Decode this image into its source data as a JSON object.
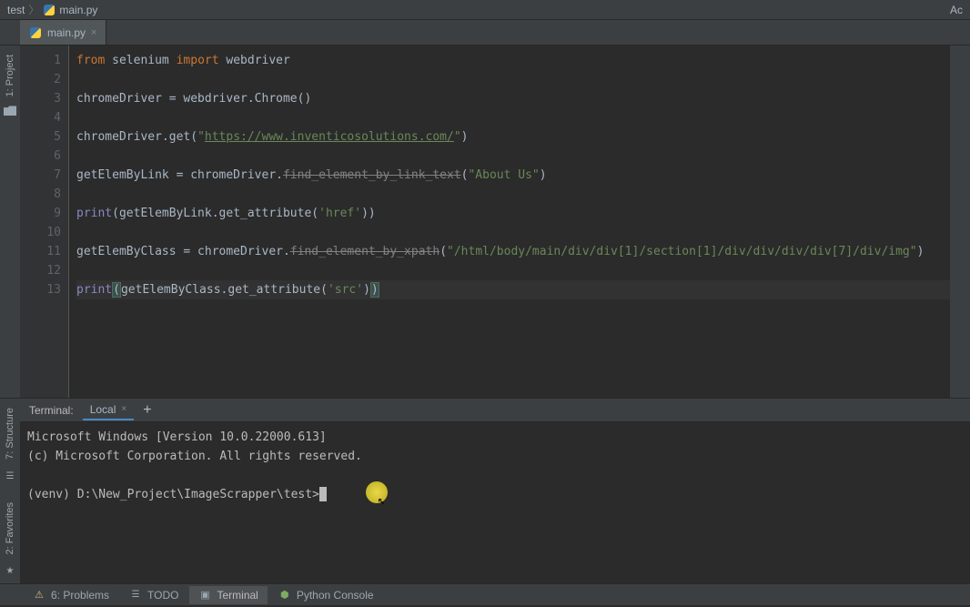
{
  "topnav": {
    "crumb_project": "test",
    "crumb_file": "main.py",
    "right": "Ac"
  },
  "tab": {
    "name": "main.py"
  },
  "sidebar": {
    "project_label": "1: Project"
  },
  "editor": {
    "line_count": 13,
    "code_tokens": [
      [
        {
          "t": "from",
          "c": "kw"
        },
        {
          "t": " ",
          "c": "ident"
        },
        {
          "t": "selenium",
          "c": "ident"
        },
        {
          "t": " ",
          "c": "ident"
        },
        {
          "t": "import",
          "c": "kw"
        },
        {
          "t": " ",
          "c": "ident"
        },
        {
          "t": "webdriver",
          "c": "ident"
        }
      ],
      [],
      [
        {
          "t": "chromeDriver = webdriver.Chrome()",
          "c": "ident"
        }
      ],
      [],
      [
        {
          "t": "chromeDriver.get(",
          "c": "ident"
        },
        {
          "t": "\"",
          "c": "str"
        },
        {
          "t": "https://www.inventicosolutions.com/",
          "c": "str-url"
        },
        {
          "t": "\"",
          "c": "str"
        },
        {
          "t": ")",
          "c": "ident"
        }
      ],
      [],
      [
        {
          "t": "getElemByLink = chromeDriver.",
          "c": "ident"
        },
        {
          "t": "find_element_by_link_text",
          "c": "deprecated"
        },
        {
          "t": "(",
          "c": "ident"
        },
        {
          "t": "\"About Us\"",
          "c": "str"
        },
        {
          "t": ")",
          "c": "ident"
        }
      ],
      [],
      [
        {
          "t": "print",
          "c": "builtin"
        },
        {
          "t": "(getElemByLink.get_attribute(",
          "c": "ident"
        },
        {
          "t": "'href'",
          "c": "str"
        },
        {
          "t": "))",
          "c": "ident"
        }
      ],
      [],
      [
        {
          "t": "getElemByClass = chromeDriver.",
          "c": "ident"
        },
        {
          "t": "find_element_by_xpath",
          "c": "deprecated"
        },
        {
          "t": "(",
          "c": "ident"
        },
        {
          "t": "\"/html/body/main/div/div[1]/section[1]/div/div/div/div[7]/div/img\"",
          "c": "str"
        },
        {
          "t": ")",
          "c": "ident"
        }
      ],
      [],
      [
        {
          "t": "print",
          "c": "builtin"
        },
        {
          "t": "(",
          "c": "paren-match"
        },
        {
          "t": "getElemByClass.get_attribute(",
          "c": "ident"
        },
        {
          "t": "'src'",
          "c": "str"
        },
        {
          "t": ")",
          "c": "ident"
        },
        {
          "t": ")",
          "c": "paren-match"
        }
      ]
    ]
  },
  "terminal": {
    "title": "Terminal:",
    "tab": "Local",
    "lines": [
      "Microsoft Windows [Version 10.0.22000.613]",
      "(c) Microsoft Corporation. All rights reserved.",
      "",
      "(venv) D:\\New_Project\\ImageScrapper\\test>"
    ]
  },
  "side_tools": {
    "structure": "7: Structure",
    "favorites": "2: Favorites"
  },
  "bottom": {
    "problems": "6: Problems",
    "todo": "TODO",
    "terminal": "Terminal",
    "pyconsole": "Python Console"
  }
}
